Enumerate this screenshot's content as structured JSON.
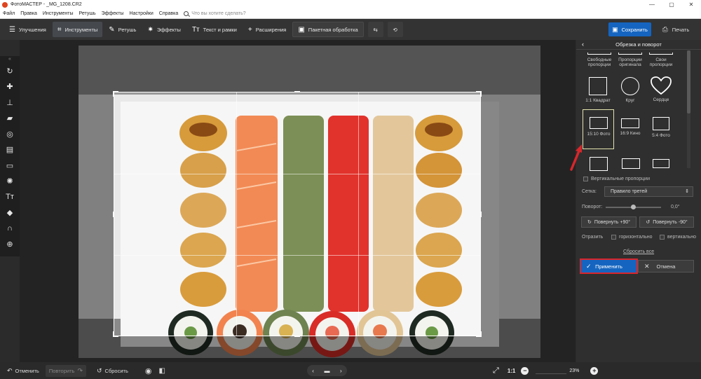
{
  "window": {
    "title": "ФотоМАСТЕР - _MG_1208.CR2",
    "controls": [
      "—",
      "▢",
      "✕"
    ]
  },
  "menu": {
    "items": [
      "Файл",
      "Правка",
      "Инструменты",
      "Ретушь",
      "Эффекты",
      "Настройки",
      "Справка"
    ],
    "search_placeholder": "Что вы хотите сделать?"
  },
  "toolbar": {
    "tabs": [
      {
        "label": "Улучшения",
        "icon": "sliders-icon",
        "glyph": "☰"
      },
      {
        "label": "Инструменты",
        "icon": "crop-icon",
        "glyph": "⌗",
        "active": true
      },
      {
        "label": "Ретушь",
        "icon": "brush-icon",
        "glyph": "✎"
      },
      {
        "label": "Эффекты",
        "icon": "sparkle-icon",
        "glyph": "✷"
      },
      {
        "label": "Текст и рамки",
        "icon": "text-icon",
        "glyph": "Tт"
      },
      {
        "label": "Расширения",
        "icon": "plus-icon",
        "glyph": "+"
      },
      {
        "label": "Пакетная обработка",
        "icon": "batch-icon",
        "glyph": "▣"
      }
    ],
    "save_label": "Сохранить",
    "print_label": "Печать"
  },
  "left_tools": [
    "rotate-tool-icon",
    "healing-tool-icon",
    "stamp-tool-icon",
    "eraser-tool-icon",
    "focus-tool-icon",
    "gradient-tool-icon",
    "vignette-tool-icon",
    "light-tool-icon",
    "text-tool-icon",
    "fill-tool-icon",
    "frame-tool-icon",
    "globe-tool-icon"
  ],
  "panel": {
    "title": "Обрезка и поворот",
    "presets": [
      {
        "label": "Свободные пропорции"
      },
      {
        "label": "Пропорции оригинала"
      },
      {
        "label": "Свои пропорции"
      },
      {
        "label": "1:1 Квадрат"
      },
      {
        "label": "Круг"
      },
      {
        "label": "Сердце"
      },
      {
        "label": "15:10 Фото",
        "selected": true
      },
      {
        "label": "16:9 Кино"
      },
      {
        "label": "5:4 Фото"
      }
    ],
    "vertical_label": "Вертикальные пропорции",
    "grid_label": "Сетка:",
    "grid_value": "Правило третей",
    "rotation_label": "Поворот:",
    "rotation_value": "0,0°",
    "rotation_fraction": 0.5,
    "rotate_plus": "Повернуть +90°",
    "rotate_minus": "Повернуть -90°",
    "flip_label": "Отразить",
    "flip_h": "горизонтально",
    "flip_v": "вертикально",
    "reset_all": "Сбросить все",
    "apply_label": "Применить",
    "cancel_label": "Отмена"
  },
  "bottom": {
    "undo": "Отменить",
    "redo": "Повторить",
    "reset": "Сбросить",
    "ratio": "1:1",
    "zoom": "23%"
  },
  "colors": {
    "accent": "#1565c0",
    "highlight": "#d8262b"
  }
}
